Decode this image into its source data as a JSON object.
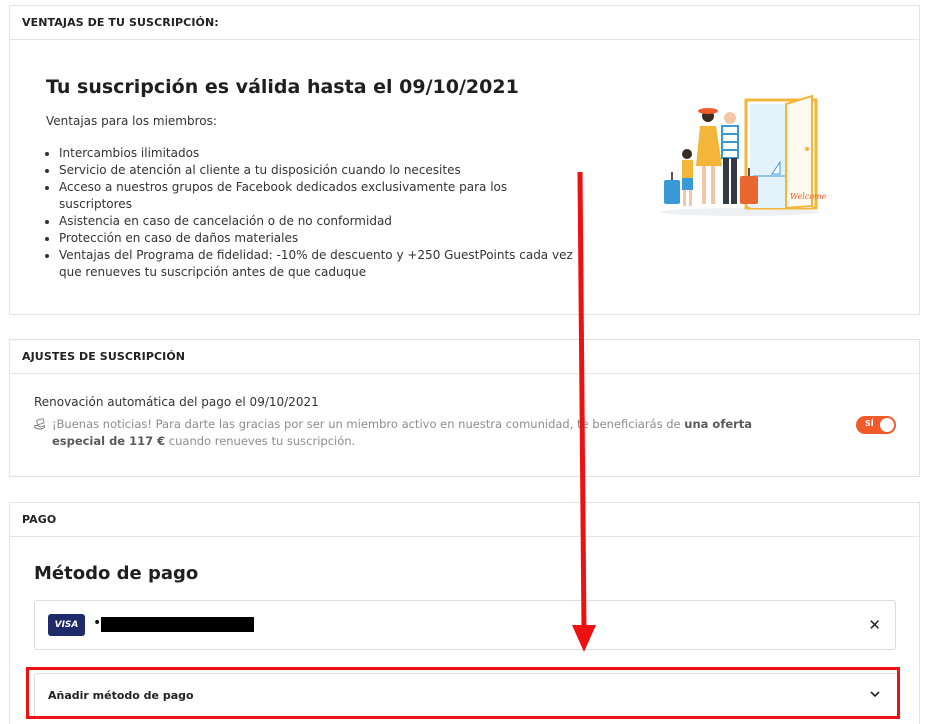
{
  "benefits_section": {
    "header": "VENTAJAS DE TU SUSCRIPCIÓN:",
    "title": "Tu suscripción es válida hasta el 09/10/2021",
    "lead": "Ventajas para los miembros:",
    "items": [
      "Intercambios ilimitados",
      "Servicio de atención al cliente a tu disposición cuando lo necesites",
      "Acceso a nuestros grupos de Facebook dedicados exclusivamente para los suscriptores",
      "Asistencia en caso de cancelación o de no conformidad",
      "Protección en caso de daños materiales",
      "Ventajas del Programa de fidelidad: -10% de descuento y +250 GuestPoints cada vez que renueves tu suscripción antes de que caduque"
    ],
    "illustration_sign": "Welcome"
  },
  "settings_section": {
    "header": "AJUSTES DE SUSCRIPCIÓN",
    "renew_label": "Renovación automática del pago el 09/10/2021",
    "notice_prefix": "¡Buenas noticias! Para darte las gracias por ser un miembro activo en nuestra comunidad, te beneficiarás de ",
    "notice_offer": "una oferta especial de 117 €",
    "notice_suffix": " cuando renueves tu suscripción.",
    "toggle_label": "SÍ",
    "toggle_on": true
  },
  "payment_section": {
    "header": "PAGO",
    "method_title": "Método de pago",
    "card_brand": "VISA",
    "card_bullet": "•",
    "remove_icon": "close-icon",
    "add_label": "Añadir método de pago"
  },
  "colors": {
    "accent_orange": "#f05a28",
    "visa_navy": "#1f2a6b",
    "annotation_red": "#ee1111"
  }
}
